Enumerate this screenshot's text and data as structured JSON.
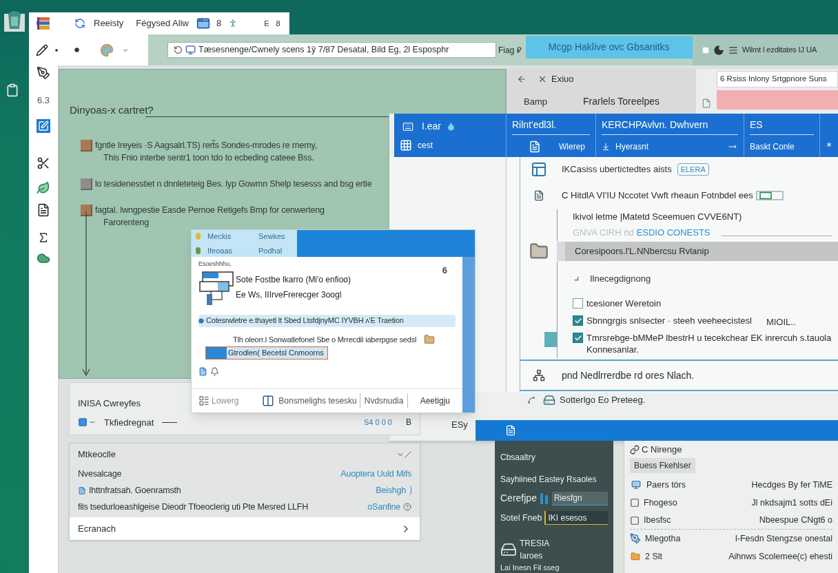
{
  "title_bar": {
    "app_name": "Reeisty",
    "menu": "Fégysed Aliw",
    "count": "8",
    "controls": [
      "E",
      "8"
    ]
  },
  "tool_rail": {
    "label": "6.3"
  },
  "toolbar": {
    "address": "Tæsesnenge/Cwnely scens 1ŷ 7/87 Desatal, Bild Eg, 2l Esposphr",
    "tag": "Fiag ₽",
    "action": "Mcgp Haklive ovc Gbsanitks",
    "status": "Wilmt l ezditates IJ UA"
  },
  "notes_panel": {
    "title": "Dinyoas-x cartret?",
    "items": [
      {
        "kind": "tan",
        "lines": [
          "fgntle Ireyeis ·S Aagsalrl.TS) rert̃s Sondes-mrodes re rnemy,",
          "This Fnio interbe sentr1 toon tdo to ecbeding cateee Bss."
        ]
      },
      {
        "kind": "grey",
        "lines": [
          "lo tesidenesstiet n dnnleteteig Bes. lyp Gowmn Shelp tesesss and bsg ertle"
        ]
      },
      {
        "kind": "tan",
        "lines": [
          "fagtal. Iwngpestie Easde Pernoe Retigefs Bmp for cenwerteng",
          "Farorenteng"
        ]
      }
    ]
  },
  "back_window": {
    "nav_title": "Exiuo",
    "tab": "Bamp",
    "heading": "Frarlels Toreelpes",
    "search_value": "6 Rsiss Inlony Srtgpnore Suns"
  },
  "ribbon": {
    "columns": [
      {
        "top": "I.ear",
        "bottom": "cest"
      },
      {
        "top": "Rilnt'edl3l.",
        "bottom": "Wlerep"
      },
      {
        "top": "KERCHPAvlvn. Dwhvern",
        "bottom": "Hyerasnt"
      },
      {
        "top": "ES",
        "bottom": "Baskt Conle"
      }
    ]
  },
  "details": {
    "items": [
      {
        "kind": "tagged",
        "label": "IKCasiss ubertictedtes aists",
        "tag": "ELERA"
      },
      {
        "kind": "heading",
        "label": "C HitdlA VI'IU Nccotet Vwft rheaun Fotnbdel ees"
      },
      {
        "kind": "sub",
        "label": "Ikivol letme |Matetd Sceemuen CVVE6NT)"
      },
      {
        "kind": "link",
        "faded": "GNVA CIRH ńd",
        "link": "ESDIO CONESTS"
      },
      {
        "kind": "row",
        "label": "Coresipoors.l'L.NNbercsu Rvlanip",
        "selected": true
      },
      {
        "kind": "expander",
        "label": "Ilnecegdignong"
      },
      {
        "kind": "check",
        "label": "tcesioner Weretoin",
        "checked": false,
        "flagged": false
      },
      {
        "kind": "check",
        "label": "Sbnngrgis snlsecter · steeh veeheecistesl",
        "note": "MIOIL..",
        "checked": true,
        "flagged": false
      },
      {
        "kind": "check",
        "label": "Tmrsrebge-bMMeP lbestrH u tecekchear EK inrercuh s.tauola Konnesanlar.",
        "checked": true,
        "flagged": true
      }
    ],
    "section": "pnd Nedlrrerdbe rd ores Nlach.",
    "footer": "Sotterlgo Eo Preteeg."
  },
  "dialog": {
    "header_items": [
      "Meckis",
      "Sewkes",
      "Ifeoaas",
      "Podhal"
    ],
    "caption": "Esoeshhhu,",
    "corner": "6",
    "entries": [
      {
        "kind": "media",
        "lines": [
          "Sote Fostbe lkarro (Mi'o enfioɑ)",
          "Ee Ws, IIIrveFrerecger 3oogl"
        ]
      },
      {
        "kind": "highlight",
        "lines": [
          "Cotesrwletre e.thayetl lt Sbed LtsfdjnyMC IYVBH ʌ'E Traetion"
        ]
      },
      {
        "kind": "attachment",
        "lines": [
          "Tlh oleorr.l Sonwatlefonel Sbe o Mrrecdil iaberpgse sedsl"
        ]
      }
    ],
    "field": {
      "value": "Gtrodlen( Becetsl Cnmoorns"
    },
    "footer": [
      "Lowerg",
      "Bonsmelighs tesesku",
      "Nvdsnudia",
      "Aeetigju"
    ]
  },
  "summary_card": {
    "title": "INISA Cwreyfes",
    "row_label": "Tkfiedregnat",
    "value": "S4 0 0 0",
    "mark": "B"
  },
  "aside_label": "ESy",
  "settings_card": {
    "title": "Mtkeoclle",
    "rows": [
      {
        "kind": "plain",
        "label": "Nvesalcage",
        "value": "Auoptera Uuld Mifs"
      },
      {
        "kind": "file",
        "label": "Ihttnfratsah. Goenramsth",
        "value": "Beishgh"
      },
      {
        "kind": "help",
        "label": "fils tsedurloeashlgeise Dieodr Tfoeoclerig uti Pte Mesred LLFH",
        "value": "oSanfine"
      }
    ],
    "footer": "Ecranach"
  },
  "side_panel": {
    "title": "Cbsaaltry",
    "subtitle": "Sayhiined Eastey Rsaoles",
    "fields": [
      {
        "label": "Cerefjpe",
        "value": "Riesfgn"
      },
      {
        "label": "Sotel Fneb",
        "value": "IKI esesos"
      }
    ],
    "item": {
      "title": "TRESIA",
      "subtitle": "Iaroes"
    },
    "footer": "Lai Inesn Fil sseg"
  },
  "info_panel": {
    "header": "C Nirenge",
    "button": "Buess Fkehlser",
    "rows": [
      {
        "kind": "screen",
        "label": "Paers tórs",
        "value": "Hecdges By fer TiME"
      },
      {
        "kind": "check",
        "label": "Fhogeso",
        "value": "Jl nkdsajm1 sotts dEi"
      },
      {
        "kind": "check",
        "label": "Ibesfsc",
        "value": "Nbeespue CNgt6 o"
      },
      {
        "kind": "pen",
        "label": "Mlegotha",
        "value": "l-Fesdn Stengzse onestal"
      },
      {
        "kind": "folder",
        "label": "2 Slt",
        "value": "Aihnws Scolemee(c) ehesti"
      }
    ]
  }
}
